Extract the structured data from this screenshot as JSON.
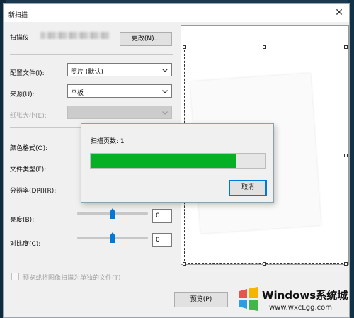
{
  "window": {
    "title": "新扫描",
    "close_glyph": "✕"
  },
  "scanner": {
    "label": "扫描仪:",
    "change_button": "更改(N)..."
  },
  "profile": {
    "label": "配置文件(I):",
    "value": "照片 (默认)"
  },
  "source": {
    "label": "来源(U):",
    "value": "平板"
  },
  "paper_size": {
    "label": "纸张大小(E):",
    "value": ""
  },
  "color_format": {
    "label": "颜色格式(O):"
  },
  "file_type": {
    "label": "文件类型(F):"
  },
  "resolution": {
    "label": "分辨率(DPI)(R):"
  },
  "brightness": {
    "label": "亮度(B):",
    "value": "0",
    "level": 0.5
  },
  "contrast": {
    "label": "对比度(C):",
    "value": "0",
    "level": 0.5
  },
  "separate_files": {
    "label": "预览或将图像扫描为单独的文件(T)",
    "checked": false
  },
  "preview_button": "预览(P)",
  "progress_dialog": {
    "status": "扫描页数: 1",
    "progress_percent": 83,
    "cancel_button": "取消",
    "progress_color": "#06b025"
  },
  "watermark": {
    "title": "Windows系统城",
    "subtitle": "www.wxcLgg.com"
  },
  "colors": {
    "accent": "#0078d7"
  }
}
